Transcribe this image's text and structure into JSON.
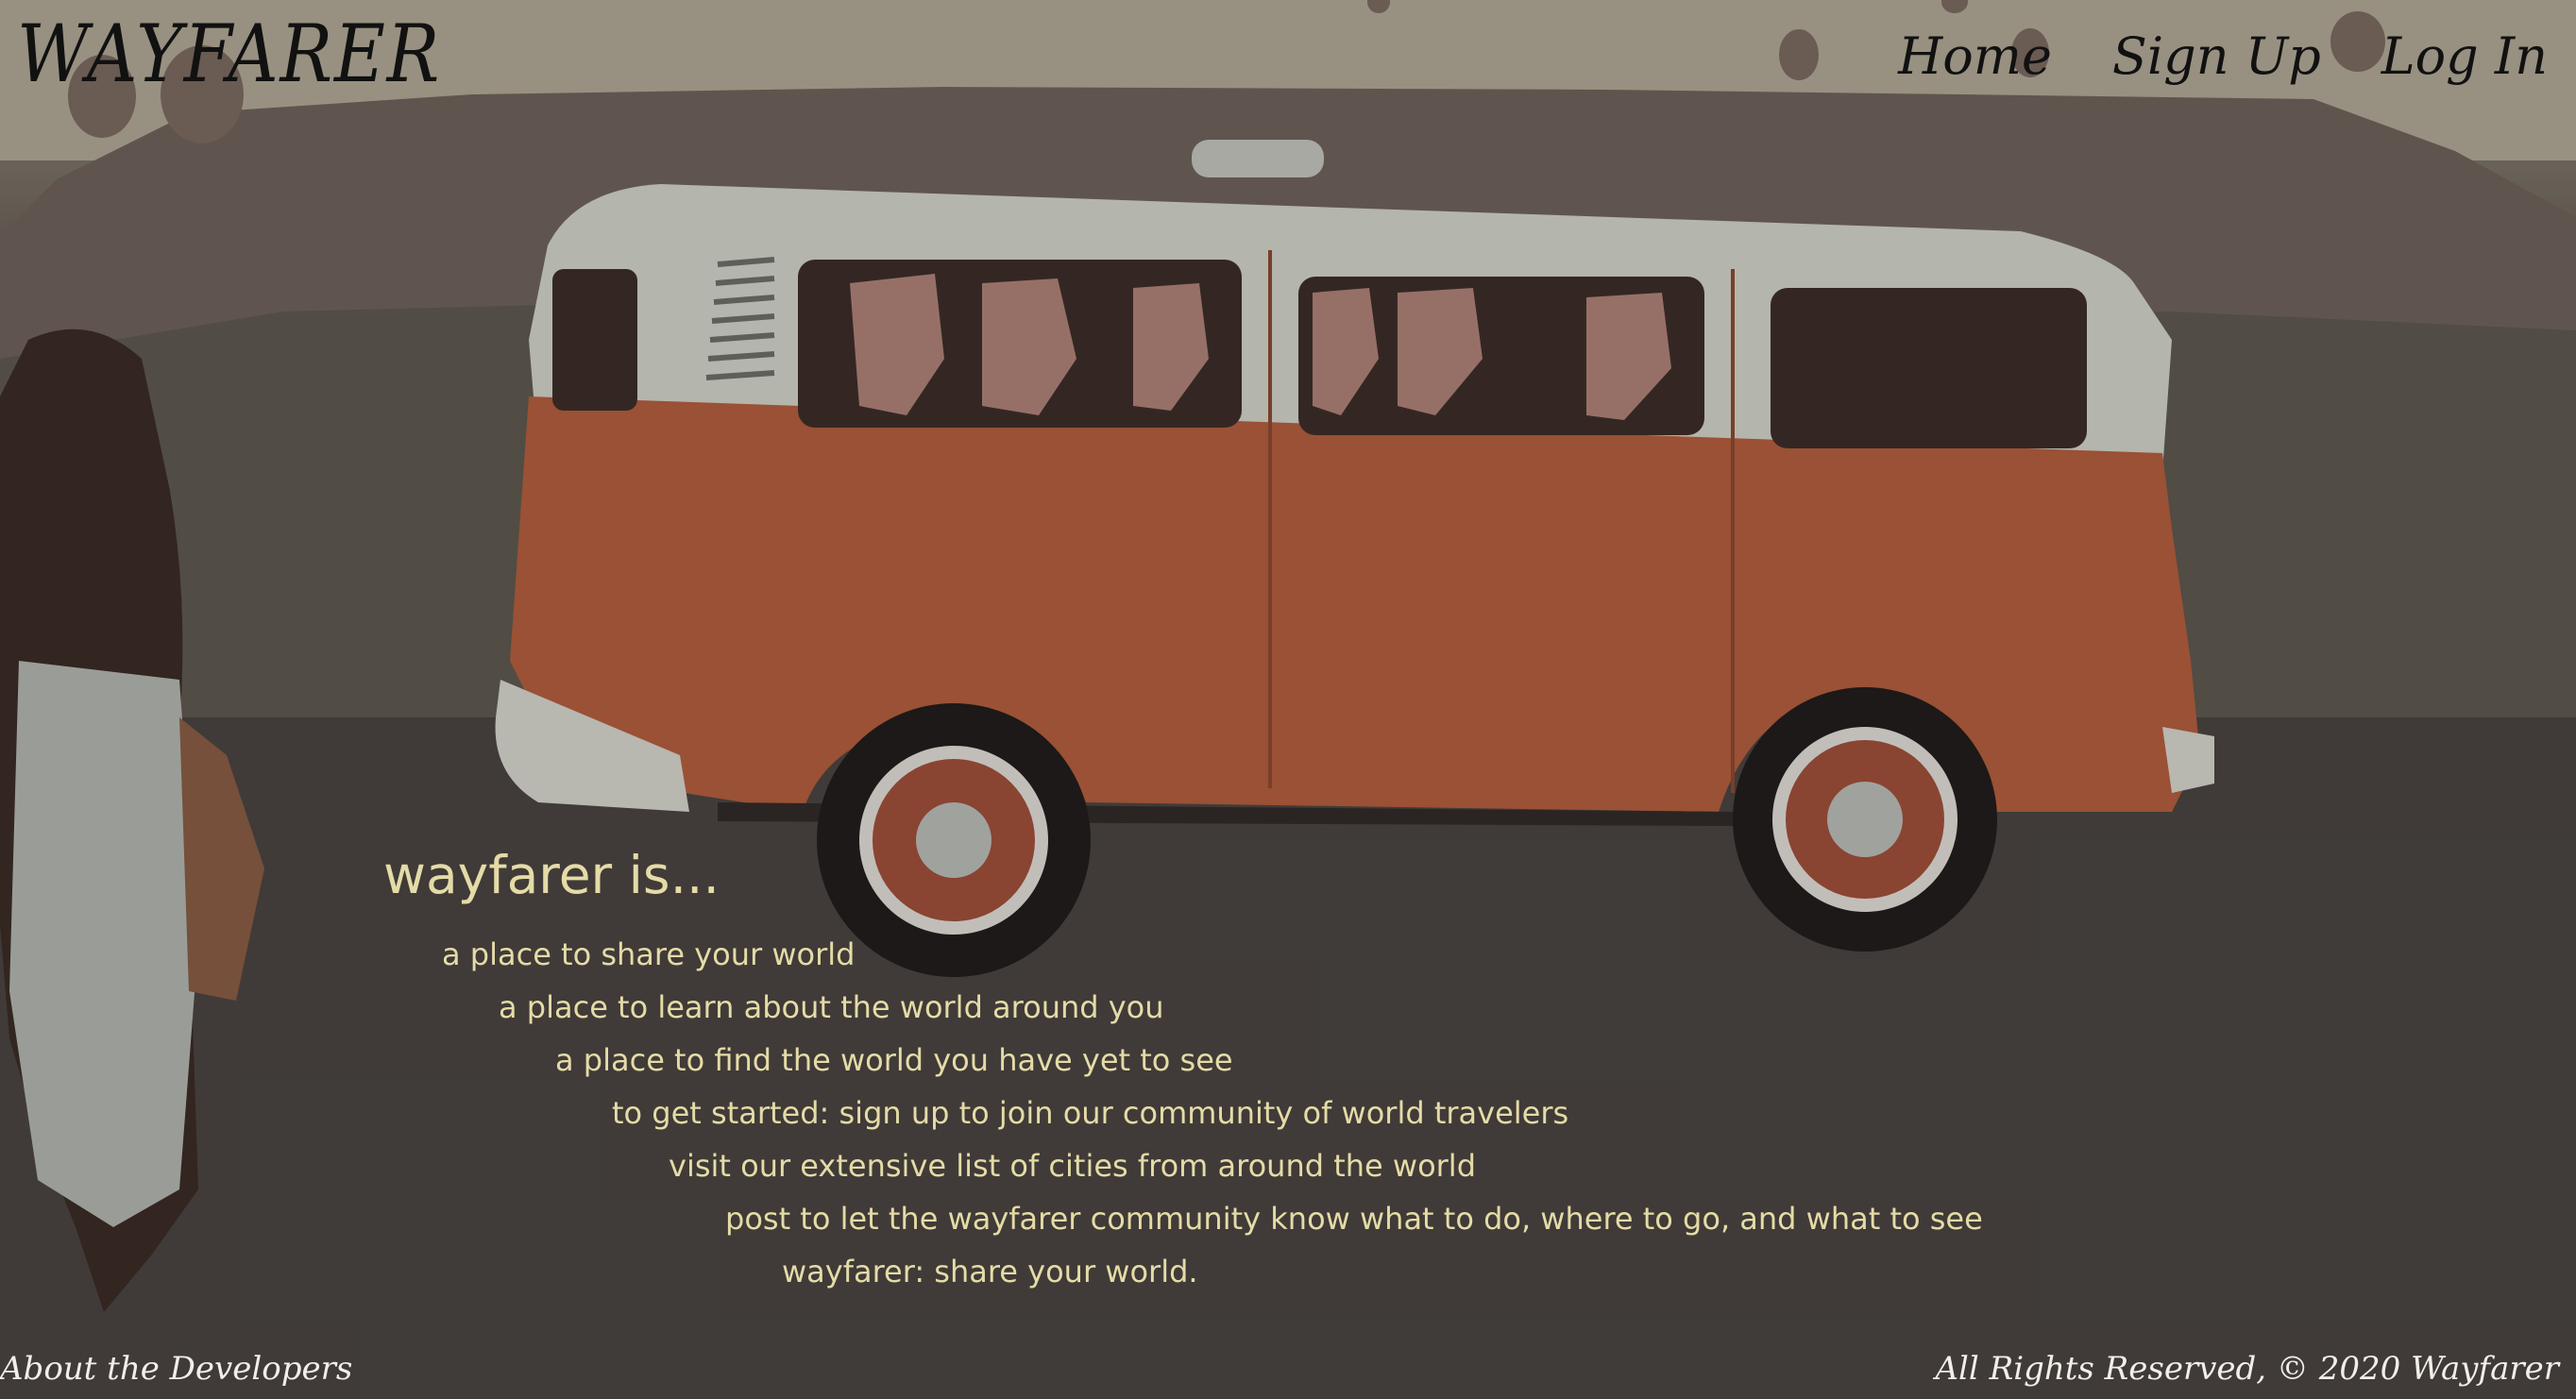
{
  "brand": {
    "logo_text": "WAYFARER"
  },
  "nav": {
    "items": [
      {
        "label": "Home"
      },
      {
        "label": "Sign Up"
      },
      {
        "label": "Log In"
      }
    ]
  },
  "hero": {
    "heading": "wayfarer is...",
    "lines": [
      "a place to share your world",
      "a place to learn about the world around you",
      "a place to find the world you have yet to see",
      "to get started: sign up to join our community of world travelers",
      "visit our extensive list of cities from around the world",
      "post to let the wayfarer community know what to do, where to go, and what to see",
      "wayfarer: share your world."
    ]
  },
  "footer": {
    "about_link": "About the Developers",
    "copyright": "All Rights Reserved, © 2020 Wayfarer"
  },
  "colors": {
    "text_accent": "#e5dba7",
    "nav_text": "#111111",
    "footer_text": "#f1efe8",
    "van_body": "#b8603d",
    "van_roof": "#d9dcd3"
  }
}
